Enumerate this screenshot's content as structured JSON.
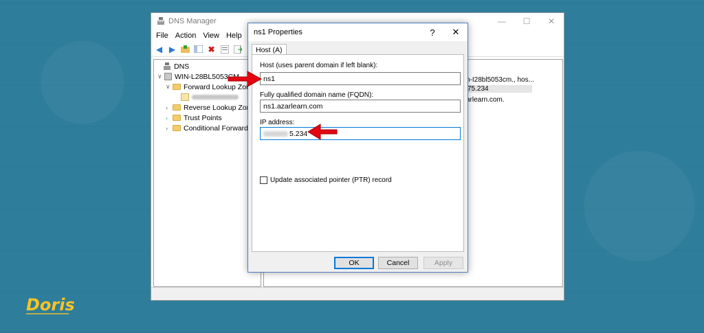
{
  "main_window": {
    "title": "DNS Manager",
    "controls": {
      "minimize": "—",
      "maximize": "☐",
      "close": "✕"
    },
    "menu": [
      "File",
      "Action",
      "View",
      "Help"
    ],
    "tree": {
      "root": "DNS",
      "server": "WIN-L28BL5053CM",
      "forward": "Forward Lookup Zones",
      "reverse": "Reverse Lookup Zones",
      "trust": "Trust Points",
      "conditional": "Conditional Forwarders"
    },
    "right_pane": {
      "line1": "n-I28bl5053cm., hos...",
      "line2": "75.234",
      "line3": "arlearn.com."
    }
  },
  "dialog": {
    "title": "ns1 Properties",
    "help": "?",
    "close": "✕",
    "tab": "Host (A)",
    "host_label": "Host (uses parent domain if left blank):",
    "host_value": "ns1",
    "fqdn_label": "Fully qualified domain name (FQDN):",
    "fqdn_value": "ns1.azarlearn.com",
    "ip_label": "IP address:",
    "ip_visible": "5.234",
    "ptr_label": "Update associated pointer (PTR) record",
    "buttons": {
      "ok": "OK",
      "cancel": "Cancel",
      "apply": "Apply"
    }
  },
  "logo": {
    "name": "Doris"
  },
  "colors": {
    "background": "#2e7d9b",
    "arrow": "#e30613",
    "logo": "#f7c325",
    "accent": "#0078d7"
  }
}
